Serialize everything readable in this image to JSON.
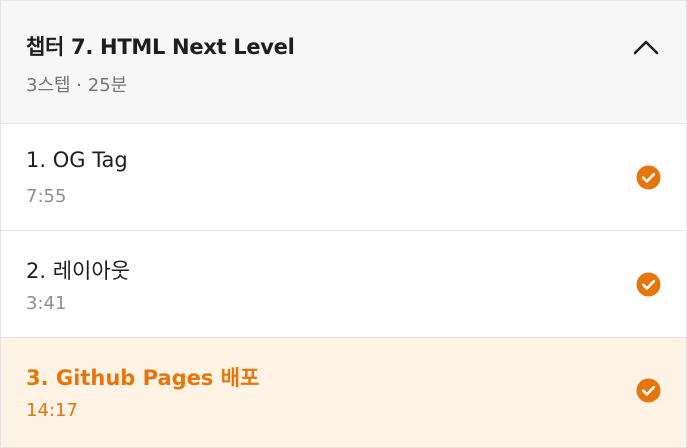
{
  "chapter": {
    "title": "챕터 7. HTML Next Level",
    "meta": "3스텝 · 25분",
    "toggle_icon": "chevron-up-icon"
  },
  "lectures": [
    {
      "title": "1. OG Tag",
      "duration": "7:55",
      "completed": true,
      "active": false
    },
    {
      "title": "2. 레이아웃",
      "duration": "3:41",
      "completed": true,
      "active": false
    },
    {
      "title": "3. Github Pages 배포",
      "duration": "14:17",
      "completed": true,
      "active": true
    }
  ],
  "colors": {
    "accent": "#e6760a",
    "active_bg": "#fff3e6",
    "header_bg": "#f7f7f7",
    "border": "#e4e4e4"
  }
}
